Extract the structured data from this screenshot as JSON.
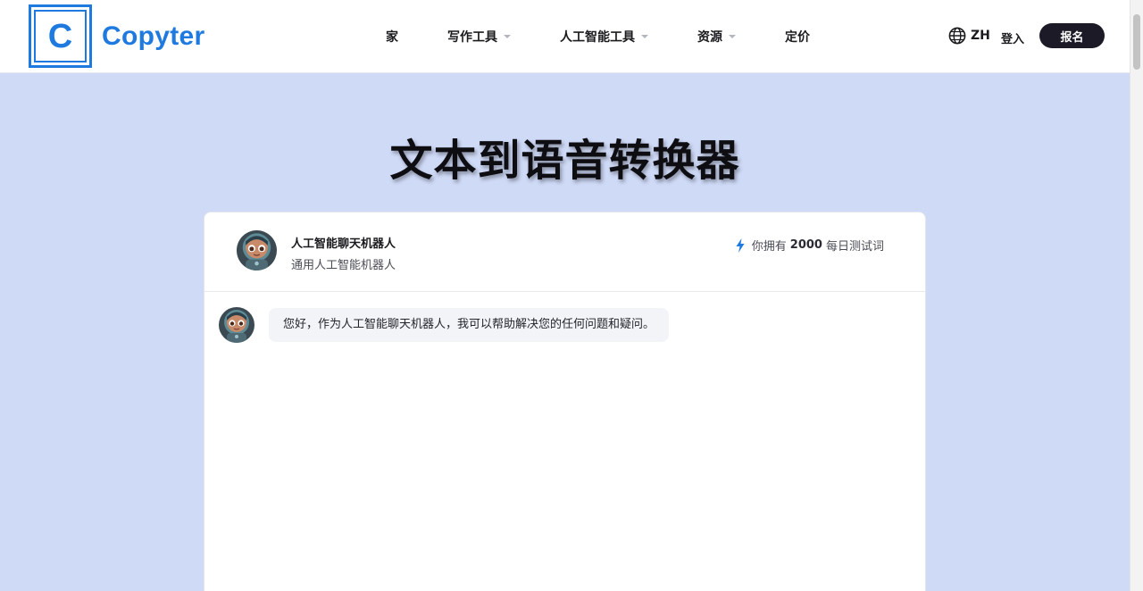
{
  "header": {
    "logo_letter": "C",
    "logo_text": "Copyter",
    "nav": [
      {
        "label": "家",
        "has_dropdown": false
      },
      {
        "label": "写作工具",
        "has_dropdown": true
      },
      {
        "label": "人工智能工具",
        "has_dropdown": true
      },
      {
        "label": "资源",
        "has_dropdown": true
      },
      {
        "label": "定价",
        "has_dropdown": false
      }
    ],
    "language": "ZH",
    "language_icon": "globe-icon",
    "login_label": "登入",
    "signup_label": "报名"
  },
  "page": {
    "title": "文本到语音转换器"
  },
  "chat": {
    "bot_name": "人工智能聊天机器人",
    "bot_description": "通用人工智能机器人",
    "credits_prefix": "你拥有",
    "credits_value": "2000",
    "credits_suffix": "每日测试词",
    "credits_icon": "lightning-bolt-icon",
    "messages": [
      {
        "sender": "bot",
        "text": "您好，作为人工智能聊天机器人，我可以帮助解决您的任何问题和疑问。"
      }
    ]
  },
  "colors": {
    "brand_blue": "#1f7ae0",
    "page_background": "#cfdaf7",
    "signup_button": "#1c1a26",
    "bubble_background": "#f2f4f8"
  }
}
